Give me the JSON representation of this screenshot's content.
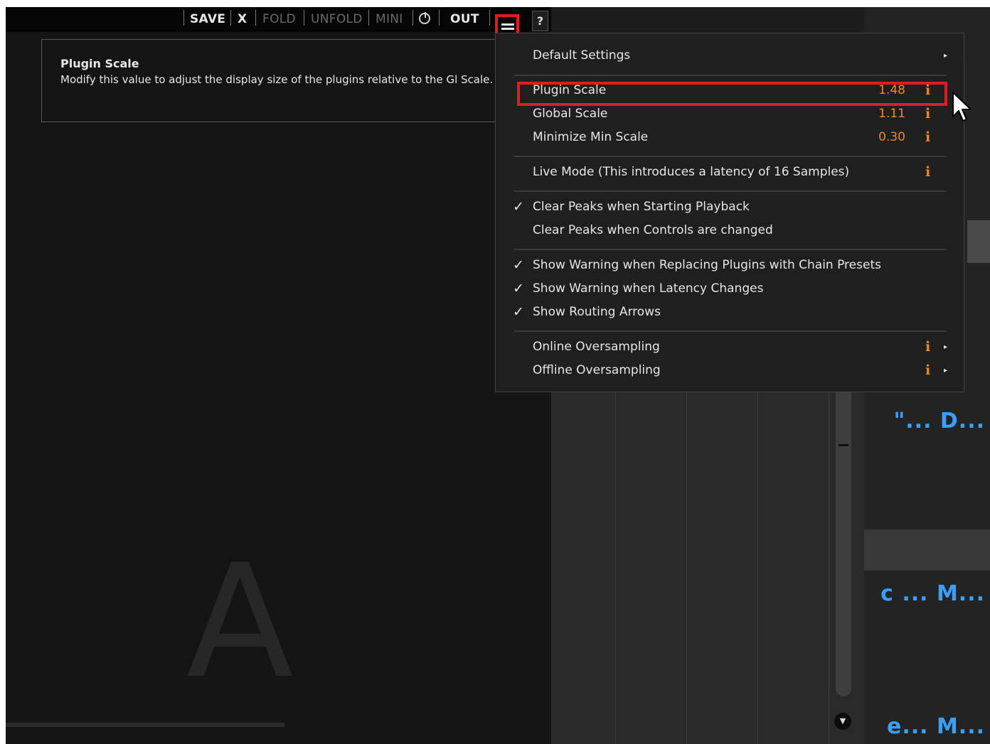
{
  "toolbar": {
    "save": "SAVE",
    "close": "X",
    "fold": "FOLD",
    "unfold": "UNFOLD",
    "mini": "MINI",
    "out": "OUT",
    "help": "?"
  },
  "info_box": {
    "title": "Plugin Scale",
    "text": "Modify this value to adjust the display size of the plugins relative to the Gl Scale."
  },
  "logo": {
    "letter": "A"
  },
  "menu": {
    "default_settings": "Default Settings",
    "plugin_scale": {
      "label": "Plugin Scale",
      "value": "1.48"
    },
    "global_scale": {
      "label": "Global Scale",
      "value": "1.11"
    },
    "minimize_min_scale": {
      "label": "Minimize Min Scale",
      "value": "0.30"
    },
    "live_mode": "Live Mode (This introduces a latency of 16 Samples)",
    "clear_peaks_playback": {
      "label": "Clear Peaks when Starting Playback",
      "checked": true
    },
    "clear_peaks_controls": {
      "label": "Clear Peaks when Controls are changed",
      "checked": false
    },
    "warn_replacing": {
      "label": "Show Warning when Replacing Plugins with Chain Presets",
      "checked": true
    },
    "warn_latency": {
      "label": "Show Warning when Latency Changes",
      "checked": true
    },
    "routing_arrows": {
      "label": "Show Routing Arrows",
      "checked": true
    },
    "online_oversampling": "Online Oversampling",
    "offline_oversampling": "Offline Oversampling",
    "info_glyph": "i",
    "check_glyph": "✓",
    "submenu_glyph": "▸"
  },
  "host": {
    "track_1": "\"... D...",
    "track_2": "c ... M...",
    "track_3": "e... M..."
  },
  "colors": {
    "accent_orange": "#f08a1c",
    "highlight_red": "#e41b1b",
    "track_blue": "#3aa0ff"
  }
}
